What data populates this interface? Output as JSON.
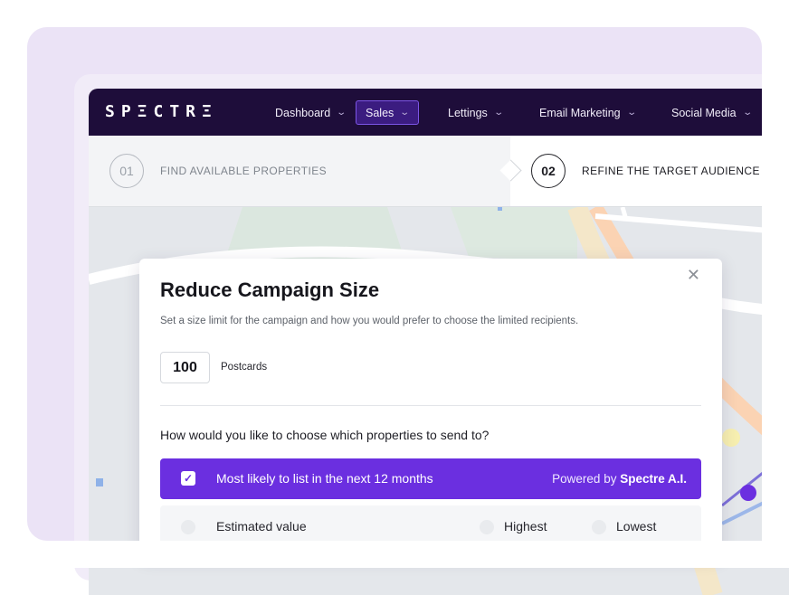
{
  "nav": {
    "logo": "SPΞCTRΞ",
    "items": [
      {
        "label": "Dashboard"
      },
      {
        "label": "Sales"
      },
      {
        "label": "Lettings"
      },
      {
        "label": "Email Marketing"
      },
      {
        "label": "Social Media"
      }
    ],
    "active_item": "Sales"
  },
  "steps": [
    {
      "number": "01",
      "label": "FIND AVAILABLE PROPERTIES"
    },
    {
      "number": "02",
      "label": "REFINE THE TARGET AUDIENCE"
    }
  ],
  "modal": {
    "title": "Reduce Campaign Size",
    "subtitle": "Set a size limit for the campaign and how you would prefer to choose the limited recipients.",
    "quantity": "100",
    "quantity_unit": "Postcards",
    "question": "How would you like to choose which properties to send to?",
    "selected_option": {
      "label": "Most likely to list in the next 12 months",
      "powered_prefix": "Powered by",
      "powered_brand": "Spectre A.I.",
      "checked": true
    },
    "second_option": {
      "label": "Estimated value",
      "choices": [
        "Highest",
        "Lowest"
      ]
    }
  },
  "colors": {
    "nav_bg": "#1e0d3a",
    "accent": "#6b2fe0",
    "background_card": "#ebe3f6"
  }
}
